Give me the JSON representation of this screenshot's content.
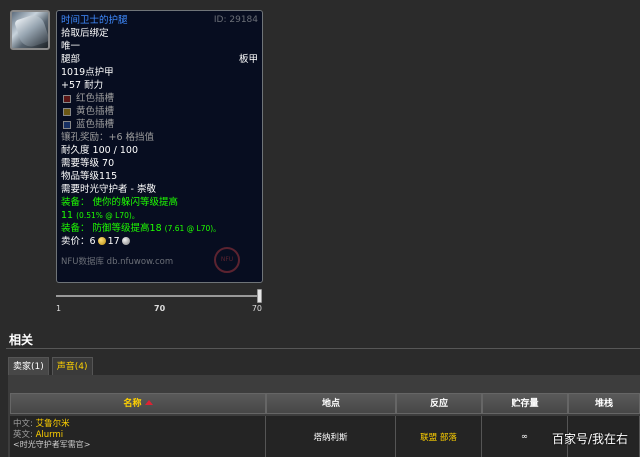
{
  "item": {
    "icon": "plate-leggings-icon",
    "title": "时间卫士的护腿",
    "id_label": "ID: 29184",
    "binding": "拾取后绑定",
    "unique": "唯一",
    "slot": "腿部",
    "armor_type": "板甲",
    "armor": "1019点护甲",
    "stamina": "+57 耐力",
    "sockets": [
      {
        "color": "red",
        "label": "红色插槽"
      },
      {
        "color": "yellow",
        "label": "黄色插槽"
      },
      {
        "color": "blue",
        "label": "蓝色插槽"
      }
    ],
    "socket_bonus": "镶孔奖励：+6 格挡值",
    "durability": "耐久度 100 / 100",
    "req_level": "需要等级 70",
    "item_level": "物品等级115",
    "req_rep": "需要时光守护者 - 崇敬",
    "equip1_line1": "装备：  使你的躲闪等级提高",
    "equip1_value": "11",
    "equip1_note": "(0.51% @ L70)。",
    "equip2_text": "装备：  防御等级提高18",
    "equip2_note": "(7.61 @ L70)。",
    "sell_label": "卖价：",
    "sell_gold": "6",
    "sell_silver": "17",
    "footer": "NFU数据库 db.nfuwow.com",
    "watermark": "NFU"
  },
  "level_slider": {
    "min": "1",
    "current": "70",
    "max": "70",
    "fraction": 1.0
  },
  "related": {
    "title": "相关",
    "tabs": [
      "卖家(1)",
      "声音(4)"
    ],
    "active_tab": 0,
    "columns": [
      "名称",
      "地点",
      "反应",
      "贮存量",
      "堆栈"
    ],
    "sorted_column": 0,
    "rows": [
      {
        "cn_label": "中文:",
        "cn_name": "艾鲁尔米",
        "en_label": "英文:",
        "en_name": "Alurmi",
        "tag": "<时光守护者军需官>",
        "location": "塔纳利斯",
        "reaction_a": "联盟",
        "reaction_b": "部落",
        "stock": "∞",
        "stack": ""
      }
    ]
  },
  "watermark_text": "百家号/我在右",
  "colors": {
    "tooltip_bg": "#070d20",
    "title_blue": "#3f8bff",
    "equip_green": "#1eff00",
    "tab_gold": "#ffd100"
  }
}
